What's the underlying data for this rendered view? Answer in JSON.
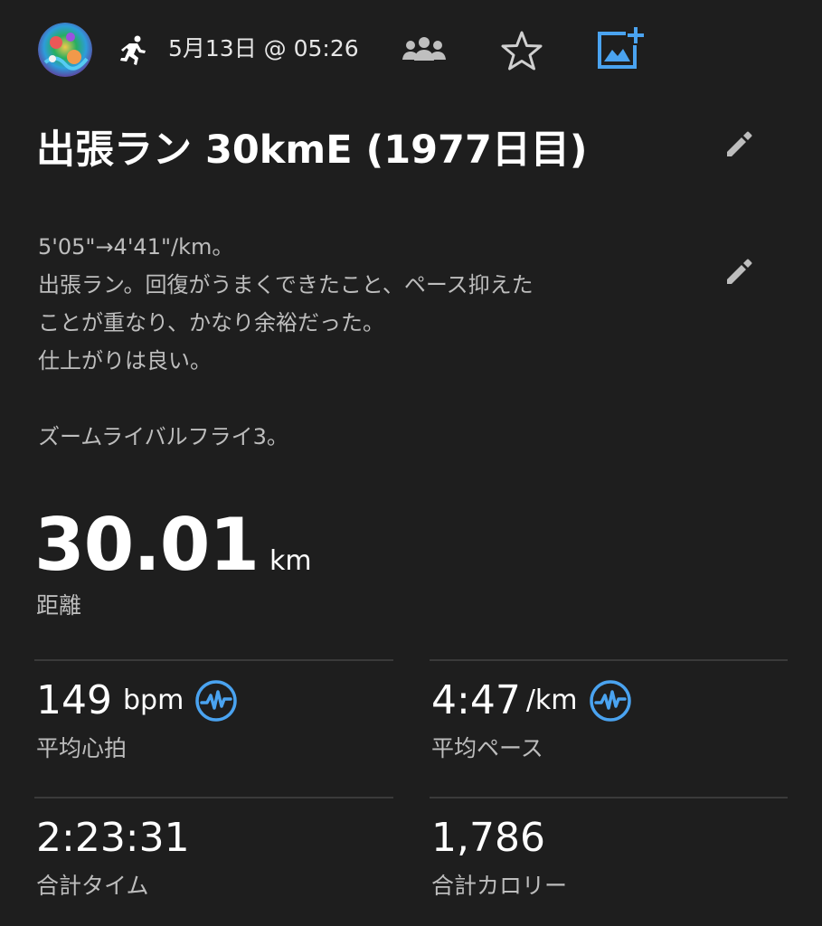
{
  "header": {
    "date": "5月13日 @ 05:26",
    "icons": {
      "activity": "running-person-icon",
      "group": "group-people-icon",
      "favorite": "star-outline-icon",
      "add_photo": "add-photo-icon"
    },
    "accent_color": "#4aa3f0"
  },
  "activity": {
    "title": "出張ラン 30kmE (1977日目)",
    "description_lines": [
      "5'05\"→4'41\"/km。",
      "出張ラン。回復がうまくできたこと、ペース抑えた",
      "ことが重なり、かなり余裕だった。",
      "仕上がりは良い。",
      "",
      "ズームライバルフライ3。"
    ]
  },
  "distance": {
    "value": "30.01",
    "unit": "km",
    "label": "距離"
  },
  "stats": {
    "heart_rate": {
      "value": "149",
      "unit": "bpm",
      "label": "平均心拍"
    },
    "pace": {
      "value": "4:47",
      "unit": "/km",
      "label": "平均ペース"
    },
    "time": {
      "value": "2:23:31",
      "label": "合計タイム"
    },
    "calories": {
      "value": "1,786",
      "label": "合計カロリー"
    }
  }
}
